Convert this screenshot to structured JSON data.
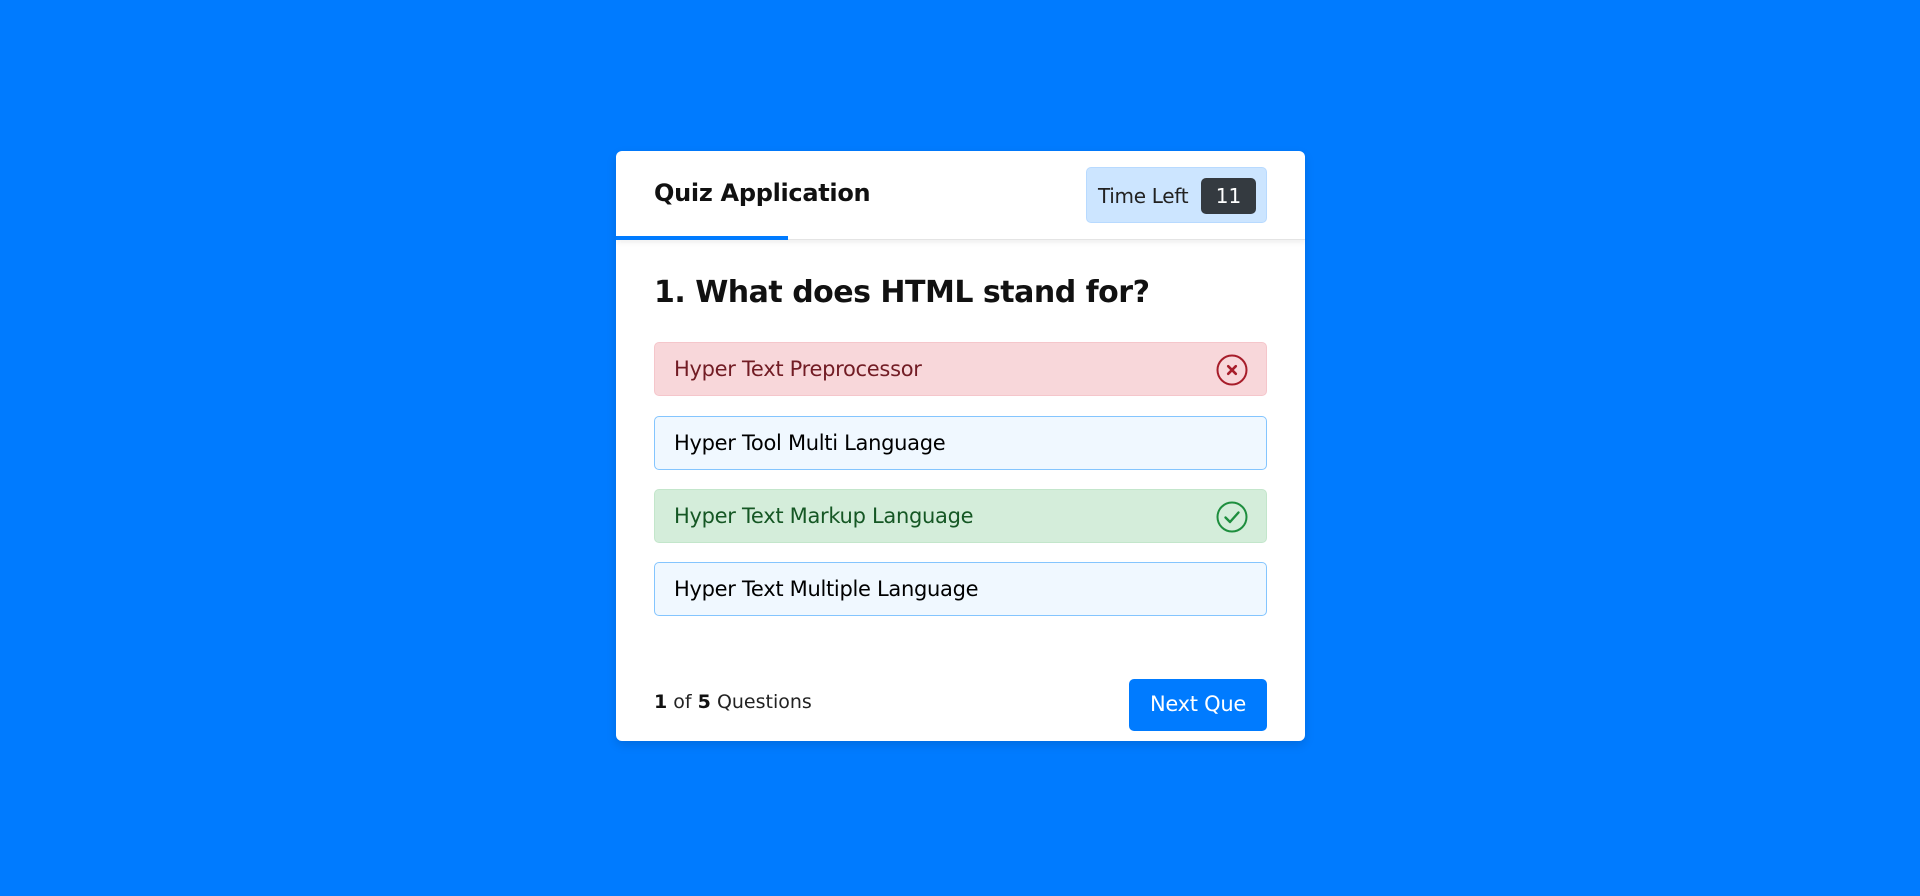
{
  "colors": {
    "background": "#007bff",
    "accent": "#007bff",
    "incorrect_bg": "#f8d7da",
    "correct_bg": "#d4edda",
    "option_bg": "#f0f8ff"
  },
  "header": {
    "title": "Quiz Application",
    "timer_label": "Time Left",
    "timer_seconds": "11",
    "time_progress_fraction": 0.25
  },
  "question": {
    "text": "1. What does HTML stand for?"
  },
  "options": [
    {
      "label": "Hyper Text Preprocessor",
      "state": "incorrect",
      "icon": "cross-circle-icon"
    },
    {
      "label": "Hyper Tool Multi Language",
      "state": "neutral"
    },
    {
      "label": "Hyper Text Markup Language",
      "state": "correct",
      "icon": "check-circle-icon"
    },
    {
      "label": "Hyper Text Multiple Language",
      "state": "neutral"
    }
  ],
  "footer": {
    "current": "1",
    "of_text": "of",
    "total": "5",
    "questions_text": "Questions",
    "next_label": "Next Que"
  }
}
